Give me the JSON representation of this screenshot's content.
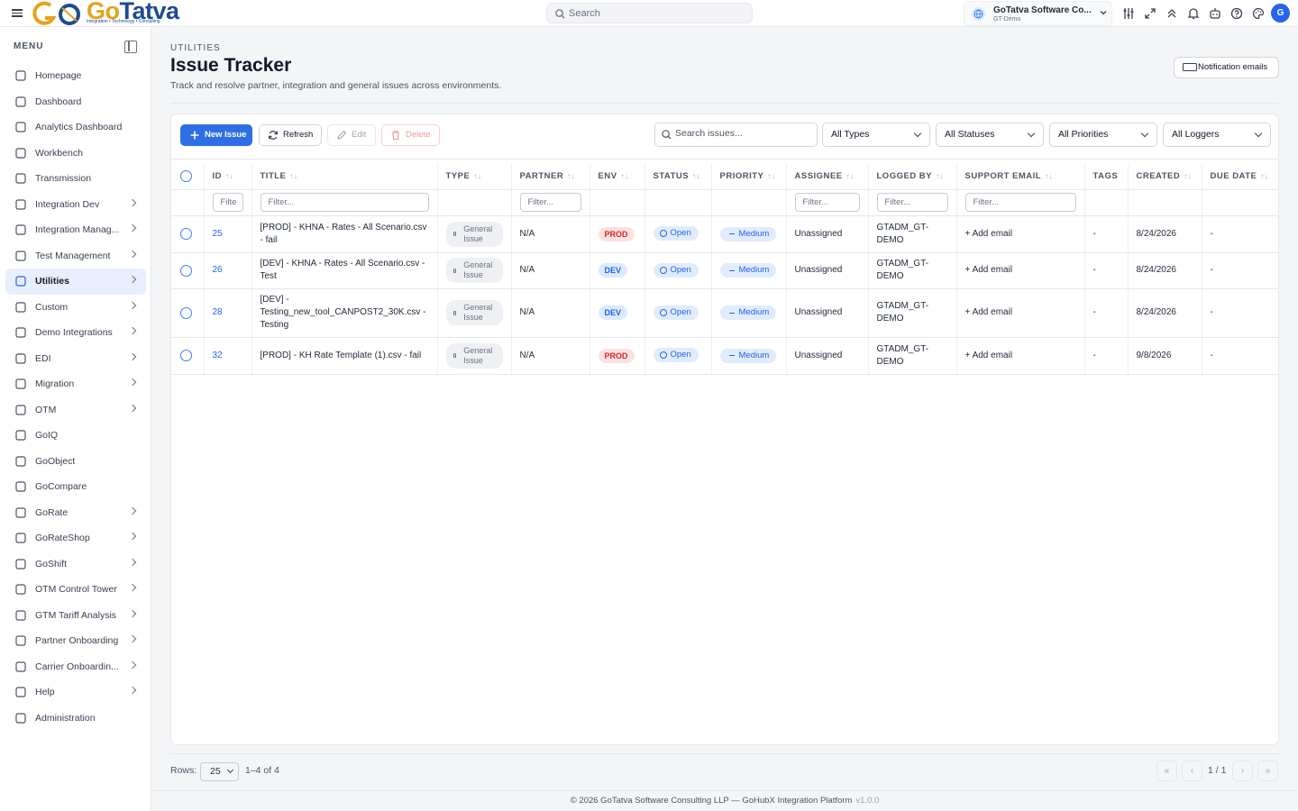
{
  "topbar": {
    "logo_text_a": "Go",
    "logo_text_b": "Tatva",
    "logo_tagline": "Integration • Technology • Consulting",
    "search_placeholder": "Search",
    "org_name": "GoTatva Software Co...",
    "org_env": "GT-Demo",
    "avatar_initial": "G"
  },
  "sidebar": {
    "heading": "MENU",
    "items": [
      {
        "label": "Homepage",
        "icon": "building-icon",
        "chevron": false
      },
      {
        "label": "Dashboard",
        "icon": "line-chart-icon",
        "chevron": false
      },
      {
        "label": "Analytics Dashboard",
        "icon": "bar-chart-icon",
        "chevron": false
      },
      {
        "label": "Workbench",
        "icon": "monitor-icon",
        "chevron": false
      },
      {
        "label": "Transmission",
        "icon": "server-icon",
        "chevron": false
      },
      {
        "label": "Integration Dev",
        "icon": "gear-icon",
        "chevron": true
      },
      {
        "label": "Integration Manag...",
        "icon": "grid-icon",
        "chevron": true
      },
      {
        "label": "Test Management",
        "icon": "checkbox-icon",
        "chevron": true
      },
      {
        "label": "Utilities",
        "icon": "wrench-icon",
        "chevron": true,
        "active": true
      },
      {
        "label": "Custom",
        "icon": "sliders-icon",
        "chevron": true
      },
      {
        "label": "Demo Integrations",
        "icon": "store-icon",
        "chevron": true
      },
      {
        "label": "EDI",
        "icon": "network-icon",
        "chevron": true
      },
      {
        "label": "Migration",
        "icon": "migration-icon",
        "chevron": true
      },
      {
        "label": "OTM",
        "icon": "truck-icon",
        "chevron": true
      },
      {
        "label": "GoIQ",
        "icon": "library-icon",
        "chevron": false
      },
      {
        "label": "GoObject",
        "icon": "target-icon",
        "chevron": false
      },
      {
        "label": "GoCompare",
        "icon": "compare-icon",
        "chevron": false
      },
      {
        "label": "GoRate",
        "icon": "dollar-icon",
        "chevron": true
      },
      {
        "label": "GoRateShop",
        "icon": "dollar-box-icon",
        "chevron": true
      },
      {
        "label": "GoShift",
        "icon": "arrows-icon",
        "chevron": true
      },
      {
        "label": "OTM Control Tower",
        "icon": "compass-icon",
        "chevron": true
      },
      {
        "label": "GTM Tariff Analysis",
        "icon": "percent-icon",
        "chevron": true
      },
      {
        "label": "Partner Onboarding",
        "icon": "users-icon",
        "chevron": true
      },
      {
        "label": "Carrier Onboardin...",
        "icon": "id-card-icon",
        "chevron": true
      },
      {
        "label": "Help",
        "icon": "help-icon",
        "chevron": true
      },
      {
        "label": "Administration",
        "icon": "admin-users-icon",
        "chevron": false
      }
    ]
  },
  "page": {
    "breadcrumb": "UTILITIES",
    "title": "Issue Tracker",
    "description": "Track and resolve partner, integration and general issues across environments.",
    "notif_button": "Notification emails"
  },
  "toolbar": {
    "new_label": "New Issue",
    "refresh_label": "Refresh",
    "edit_label": "Edit",
    "delete_label": "Delete",
    "search_placeholder": "Search issues...",
    "filter_types": "All Types",
    "filter_statuses": "All Statuses",
    "filter_priorities": "All Priorities",
    "filter_loggers": "All Loggers"
  },
  "table": {
    "headers": [
      "ID",
      "TITLE",
      "TYPE",
      "PARTNER",
      "ENV",
      "STATUS",
      "PRIORITY",
      "ASSIGNEE",
      "LOGGED BY",
      "SUPPORT EMAIL",
      "TAGS",
      "CREATED",
      "DUE DATE"
    ],
    "filter_placeholders": {
      "id": "Filte",
      "title": "Filter...",
      "partner": "Filter...",
      "assignee": "Filter...",
      "logged_by": "Filter...",
      "support_email": "Filter..."
    },
    "rows": [
      {
        "id": "25",
        "title": "[PROD] - KHNA - Rates - All Scenario.csv - fail",
        "type": "General Issue",
        "partner": "N/A",
        "env": "PROD",
        "status": "Open",
        "priority": "Medium",
        "assignee": "Unassigned",
        "logged_by": "GTADM_GT-DEMO",
        "support_email": "+ Add email",
        "tags": "-",
        "created": "8/24/2026",
        "due": "-"
      },
      {
        "id": "26",
        "title": "[DEV] - KHNA - Rates - All Scenario.csv - Test",
        "type": "General Issue",
        "partner": "N/A",
        "env": "DEV",
        "status": "Open",
        "priority": "Medium",
        "assignee": "Unassigned",
        "logged_by": "GTADM_GT-DEMO",
        "support_email": "+ Add email",
        "tags": "-",
        "created": "8/24/2026",
        "due": "-"
      },
      {
        "id": "28",
        "title": "[DEV] - Testing_new_tool_CANPOST2_30K.csv - Testing",
        "type": "General Issue",
        "partner": "N/A",
        "env": "DEV",
        "status": "Open",
        "priority": "Medium",
        "assignee": "Unassigned",
        "logged_by": "GTADM_GT-DEMO",
        "support_email": "+ Add email",
        "tags": "-",
        "created": "8/24/2026",
        "due": "-"
      },
      {
        "id": "32",
        "title": "[PROD] - KH Rate Template (1).csv - fail",
        "type": "General Issue",
        "partner": "N/A",
        "env": "PROD",
        "status": "Open",
        "priority": "Medium",
        "assignee": "Unassigned",
        "logged_by": "GTADM_GT-DEMO",
        "support_email": "+ Add email",
        "tags": "-",
        "created": "9/8/2026",
        "due": "-"
      }
    ]
  },
  "pagination": {
    "rows_label": "Rows:",
    "rows_value": "25",
    "count": "1–4 of 4",
    "page_indicator": "1 / 1",
    "first": "«",
    "prev": "‹",
    "next": "›",
    "last": "»"
  },
  "footer": {
    "copyright": "© 2026 GoTatva Software Consulting LLP — GoHubX Integration Platform",
    "version": "v1.0.0"
  },
  "colors": {
    "accent": "#2f6fe4",
    "prod": "#dc2626",
    "dev": "#2563eb",
    "brand_orange": "#e5a21b",
    "brand_blue": "#1e4b8f"
  }
}
